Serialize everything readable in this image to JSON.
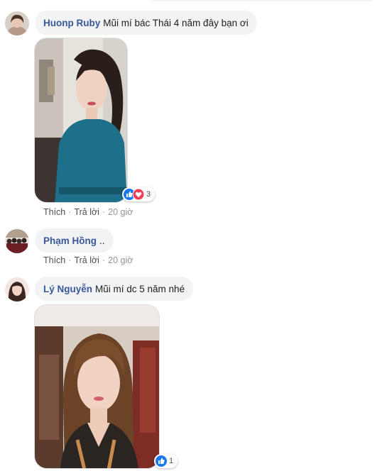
{
  "comments": [
    {
      "author": "Huonp Ruby",
      "text": "Mũi mí bác Thái 4 năm đây bạn ơi",
      "reaction_count": "3",
      "actions": {
        "like": "Thích",
        "reply": "Trả lời",
        "time": "20 giờ"
      }
    },
    {
      "author": "Phạm Hồng",
      "text": "..",
      "actions": {
        "like": "Thích",
        "reply": "Trả lời",
        "time": "20 giờ"
      }
    },
    {
      "author": "Lý Nguyễn",
      "text": "Mũi mí dc 5 năm nhé",
      "reaction_count": "1"
    }
  ],
  "colors": {
    "author_link": "#385898",
    "bubble_bg": "#f2f3f5",
    "meta_text": "#90949c",
    "like_blue": "#1877f2",
    "love_red": "#f33e58"
  },
  "icons": [
    "like-reaction-icon",
    "love-reaction-icon"
  ]
}
